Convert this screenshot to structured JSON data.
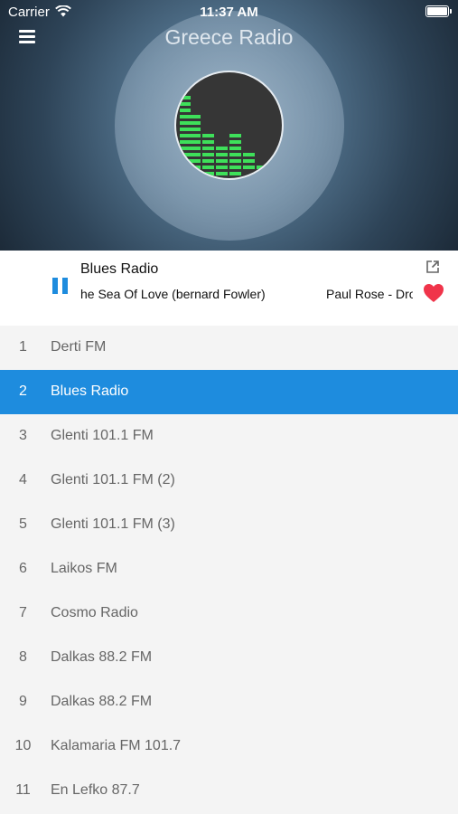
{
  "status_bar": {
    "carrier": "Carrier",
    "time": "11:37 AM"
  },
  "header": {
    "title": "Greece Radio"
  },
  "now_playing": {
    "station": "Blues Radio",
    "track_left": "he Sea Of Love (bernard Fowler)",
    "track_right": "Paul Rose - Dro"
  },
  "colors": {
    "accent": "#1e8cde",
    "heart": "#f0344a",
    "equalizer": "#3ee05a"
  },
  "stations": [
    {
      "num": "1",
      "name": "Derti FM"
    },
    {
      "num": "2",
      "name": "Blues Radio"
    },
    {
      "num": "3",
      "name": "Glenti 101.1 FM"
    },
    {
      "num": "4",
      "name": "Glenti 101.1 FM (2)"
    },
    {
      "num": "5",
      "name": "Glenti 101.1 FM (3)"
    },
    {
      "num": "6",
      "name": "Laikos FM"
    },
    {
      "num": "7",
      "name": "Cosmo Radio"
    },
    {
      "num": "8",
      "name": "Dalkas 88.2 FM"
    },
    {
      "num": "9",
      "name": "Dalkas 88.2 FM"
    },
    {
      "num": "10",
      "name": "Kalamaria FM 101.7"
    },
    {
      "num": "11",
      "name": "En Lefko 87.7"
    }
  ],
  "active_station": "2"
}
